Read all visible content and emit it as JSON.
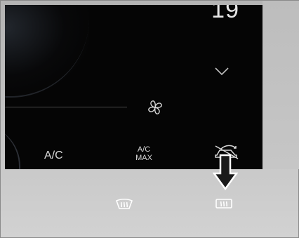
{
  "climate": {
    "temperature_partial": "19",
    "ac_label": "A/C",
    "ac_max_label": "A/C\nMAX"
  },
  "icons": {
    "chevron": "chevron-down-icon",
    "fan": "fan-icon",
    "recirculation": "recirculation-icon",
    "arrow": "arrow-down-icon",
    "defrost_front": "front-defrost-icon",
    "defrost_rear": "rear-defrost-icon"
  },
  "colors": {
    "screen_background": "#050505",
    "screen_text": "#d9d9d9",
    "bezel": "#c4c4c4"
  }
}
